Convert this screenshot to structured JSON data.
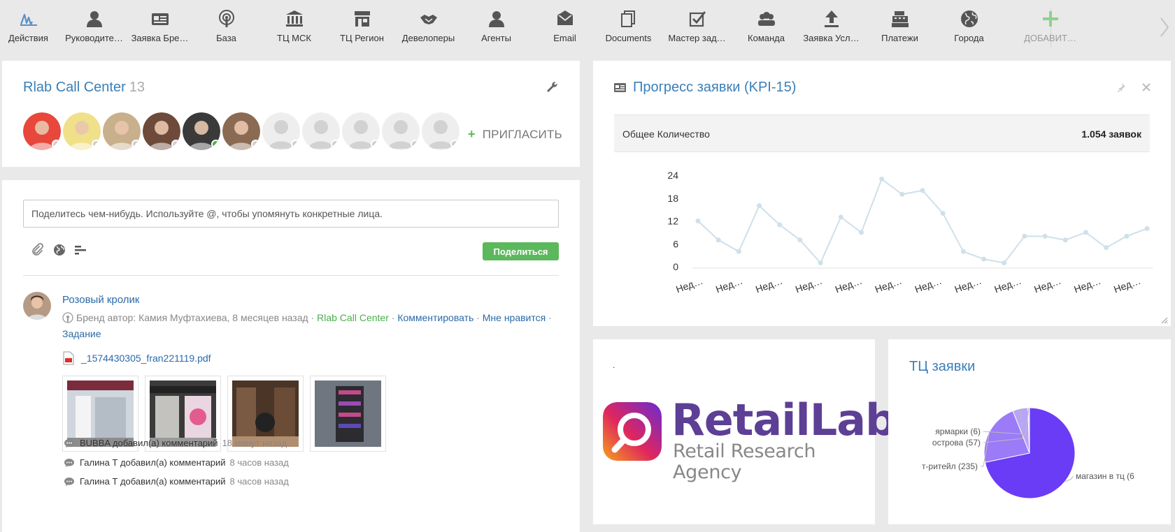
{
  "toolbar": {
    "items": [
      {
        "label": "Действия",
        "icon": "activity-icon"
      },
      {
        "label": "Руководите…",
        "icon": "person-icon"
      },
      {
        "label": "Заявка Бре…",
        "icon": "id-card-icon"
      },
      {
        "label": "База",
        "icon": "broadcast-icon"
      },
      {
        "label": "ТЦ МСК",
        "icon": "bank-icon"
      },
      {
        "label": "ТЦ Регион",
        "icon": "store-icon"
      },
      {
        "label": "Девелоперы",
        "icon": "handshake-icon"
      },
      {
        "label": "Агенты",
        "icon": "person-icon"
      },
      {
        "label": "Email",
        "icon": "envelope-icon"
      },
      {
        "label": "Documents",
        "icon": "documents-icon"
      },
      {
        "label": "Мастер зад…",
        "icon": "checkbox-icon"
      },
      {
        "label": "Команда",
        "icon": "team-icon"
      },
      {
        "label": "Заявка Усл…",
        "icon": "upload-icon"
      },
      {
        "label": "Платежи",
        "icon": "cash-register-icon"
      },
      {
        "label": "Города",
        "icon": "globe-icon"
      }
    ],
    "add_label": "ДОБАВИТ…"
  },
  "team": {
    "title": "Rlab Call Center",
    "count": "13",
    "invite_label": "ПРИГЛАСИТЬ",
    "members": [
      {
        "kind": "photo",
        "color": "#e8473c",
        "online": false
      },
      {
        "kind": "photo",
        "color": "#f0e08a",
        "online": false
      },
      {
        "kind": "photo",
        "color": "#c9b08c",
        "online": false
      },
      {
        "kind": "photo",
        "color": "#6e4a3a",
        "online": false
      },
      {
        "kind": "photo",
        "color": "#3a3a3a",
        "online": true
      },
      {
        "kind": "photo",
        "color": "#8a6a52",
        "online": false
      },
      {
        "kind": "placeholder",
        "online": false
      },
      {
        "kind": "placeholder",
        "online": false
      },
      {
        "kind": "placeholder",
        "online": false
      },
      {
        "kind": "placeholder",
        "online": false
      },
      {
        "kind": "placeholder",
        "online": false
      }
    ]
  },
  "feed": {
    "placeholder": "Поделитесь чем-нибудь. Используйте @, чтобы упомянуть конкретные лица.",
    "share_label": "Поделиться",
    "post": {
      "author": "Розовый кролик",
      "meta_prefix": "Бренд  автор: Камия Муфтахиева, 8 месяцев назад",
      "group": "Rlab Call Center",
      "comment_link": "Комментировать",
      "like_link": "Мне нравится",
      "task_link": "Задание",
      "attachment": "_1574430305_fran221119.pdf"
    },
    "comments": [
      {
        "text": "BUBBA добавил(а) комментарий",
        "time": "18 минут назад"
      },
      {
        "text": "Галина Т добавил(а) комментарий",
        "time": "8 часов назад"
      },
      {
        "text": "Галина Т добавил(а) комментарий",
        "time": "8 часов назад"
      }
    ]
  },
  "kpi": {
    "title": "Прогресс заявки (KPI-15)",
    "total_label": "Общее Количество",
    "total_value": "1.054 заявок"
  },
  "logo_panel": {
    "dot": ".",
    "brand": "RetailLab",
    "tagline": "Retail Research Agency"
  },
  "pie_panel": {
    "title": "ТЦ заявки"
  },
  "chart_data": [
    {
      "type": "line",
      "title": "Прогресс заявки (KPI-15)",
      "y_ticks": [
        0,
        6,
        12,
        18,
        24
      ],
      "ylim": [
        0,
        24
      ],
      "x_tick_labels": [
        "Нед…",
        "Нед…",
        "Нед…",
        "Нед…",
        "Нед…",
        "Нед…",
        "Нед…",
        "Нед…",
        "Нед…",
        "Нед…",
        "Нед…",
        "Нед…"
      ],
      "values": [
        12,
        7,
        4,
        16,
        11,
        7,
        1,
        13,
        9,
        23,
        19,
        20,
        14,
        4,
        2,
        1,
        8,
        8,
        7,
        9,
        5,
        8,
        10
      ],
      "color": "#cfe0ea",
      "grid": false
    },
    {
      "type": "pie",
      "title": "ТЦ заявки",
      "slices": [
        {
          "label": "магазин в тц (6",
          "value": 756,
          "color": "#6a3cf5"
        },
        {
          "label": "т-ритейл (235)",
          "value": 235,
          "color": "#9b7bf7"
        },
        {
          "label": "острова (57)",
          "value": 57,
          "color": "#b8a4f8"
        },
        {
          "label": "ярмарки (6)",
          "value": 6,
          "color": "#d6cafb"
        }
      ]
    }
  ]
}
